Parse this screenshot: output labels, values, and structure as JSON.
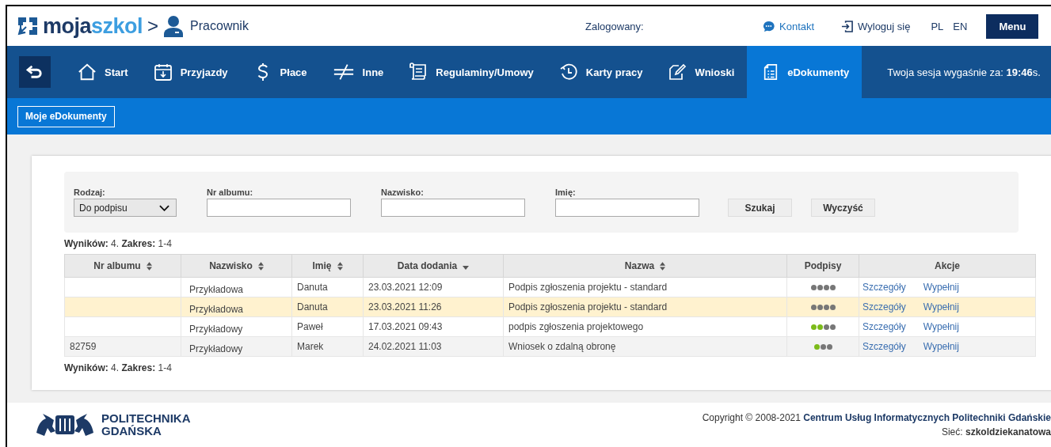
{
  "header": {
    "logo": {
      "part_1": "moja",
      "part_2": "szkol"
    },
    "separator": ">",
    "role": "Pracownik",
    "logged_in_label": "Zalogowany:",
    "links": [
      {
        "label": "Kontakt"
      },
      {
        "label": "Wyloguj się"
      }
    ],
    "languages": [
      {
        "label": "PL"
      },
      {
        "label": "EN"
      }
    ],
    "menu_button": "Menu"
  },
  "nav": {
    "items": [
      {
        "label": "Start",
        "selected": false
      },
      {
        "label": "Przyjazdy",
        "selected": false
      },
      {
        "label": "Płace",
        "selected": false
      },
      {
        "label": "Inne",
        "selected": false
      },
      {
        "label": "Regulaminy/Umowy",
        "selected": false
      },
      {
        "label": "Karty pracy",
        "selected": false
      },
      {
        "label": "Wnioski",
        "selected": false
      },
      {
        "label": "eDokumenty",
        "selected": true
      }
    ],
    "session": {
      "label": "Twoja sesja wygaśnie za:",
      "time": "19:46",
      "unit": "s."
    }
  },
  "subnav": {
    "button": "Moje eDokumenty"
  },
  "filters": {
    "type": {
      "label": "Rodzaj:",
      "value": "Do podpisu"
    },
    "fields": [
      {
        "label": "Nr albumu:"
      },
      {
        "label": "Nazwisko:"
      },
      {
        "label": "Imię:"
      }
    ],
    "buttons": [
      "Szukaj",
      "Wyczyść"
    ]
  },
  "results_top": {
    "count_label": "Wyników:",
    "count": "4.",
    "range_label": "Zakres:",
    "range": "1-4"
  },
  "table": {
    "columns": [
      {
        "label": "Nr albumu",
        "sortable": true,
        "sorted": false
      },
      {
        "label": "Nazwisko",
        "sortable": true,
        "sorted": false
      },
      {
        "label": "Imię",
        "sortable": true,
        "sorted": false
      },
      {
        "label": "Data dodania",
        "sortable": true,
        "sorted": true
      },
      {
        "label": "Nazwa",
        "sortable": true,
        "sorted": false
      },
      {
        "label": "Podpisy",
        "sortable": false,
        "sorted": false
      },
      {
        "label": "Akcje",
        "sortable": false,
        "sorted": false
      }
    ],
    "rows": [
      {
        "nr_albumu": "",
        "nazwisko": "Przykładowa",
        "imie": "Danuta",
        "data_dodania": "23.03.2021 12:09",
        "nazwa": "Podpis zgłoszenia projektu - standard",
        "signatures": [
          {
            "signed": false
          },
          {
            "signed": false
          },
          {
            "signed": false
          },
          {
            "signed": false
          }
        ],
        "actions": [
          "Szczegóły",
          "Wypełnij"
        ],
        "highlighted": false
      },
      {
        "nr_albumu": "",
        "nazwisko": "Przykładowa",
        "imie": "Danuta",
        "data_dodania": "23.03.2021 11:26",
        "nazwa": "Podpis zgłoszenia projektu - standard",
        "signatures": [
          {
            "signed": false
          },
          {
            "signed": false
          },
          {
            "signed": false
          },
          {
            "signed": false
          }
        ],
        "actions": [
          "Szczegóły",
          "Wypełnij"
        ],
        "highlighted": true
      },
      {
        "nr_albumu": "",
        "nazwisko": "Przykładowy",
        "imie": "Paweł",
        "data_dodania": "17.03.2021 09:43",
        "nazwa": "podpis zgłoszenia projektowego",
        "signatures": [
          {
            "signed": true
          },
          {
            "signed": true
          },
          {
            "signed": false
          },
          {
            "signed": false
          }
        ],
        "actions": [
          "Szczegóły",
          "Wypełnij"
        ],
        "highlighted": false
      },
      {
        "nr_albumu": "82759",
        "nazwisko": "Przykładowy",
        "imie": "Marek",
        "data_dodania": "24.02.2021 11:03",
        "nazwa": "Wniosek o zdalną obronę",
        "signatures": [
          {
            "signed": true
          },
          {
            "signed": false
          },
          {
            "signed": false
          }
        ],
        "actions": [
          "Szczegóły",
          "Wypełnij"
        ],
        "highlighted": false
      }
    ]
  },
  "results_bottom": {
    "count_label": "Wyników:",
    "count": "4.",
    "range_label": "Zakres:",
    "range": "1-4"
  },
  "footer": {
    "university": {
      "line_1": "POLITECHNIKA",
      "line_2": "GDAŃSKA"
    },
    "copyright": "Copyright © 2008-2021",
    "owner_link": "Centrum Usług Informatycznych Politechniki Gdańskie",
    "network_label": "Sieć:",
    "network": "szkoldziekanatowa"
  }
}
